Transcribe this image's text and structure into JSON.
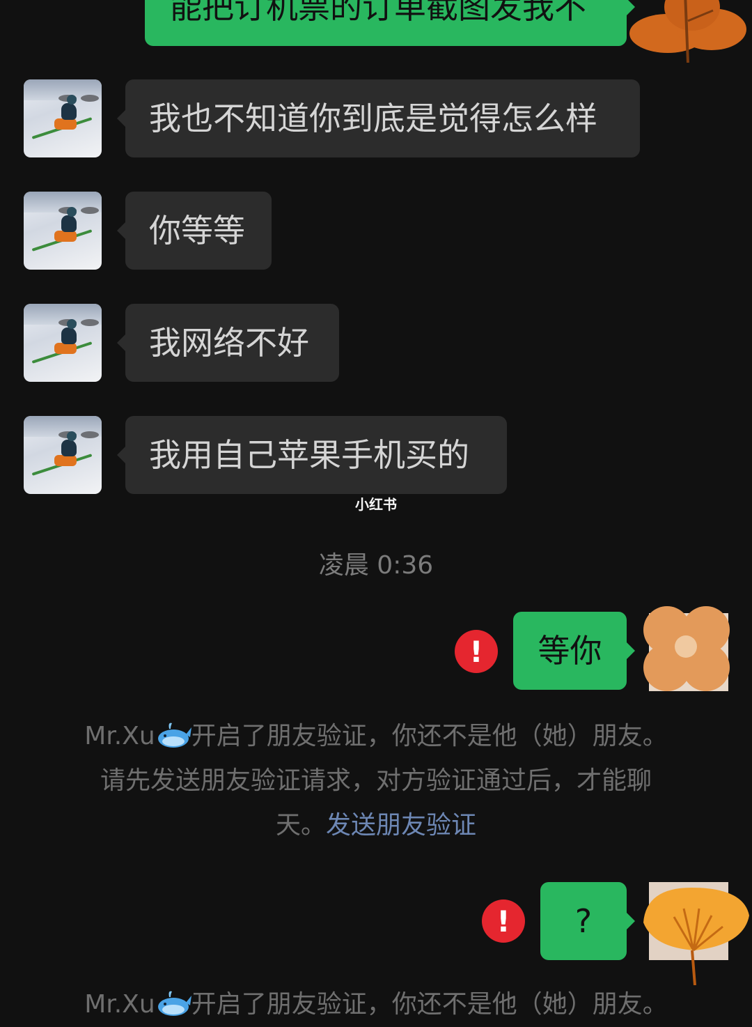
{
  "top_partial_message": {
    "text": "能把订机票的订单截图发我不"
  },
  "incoming_messages": [
    {
      "text": "我也不知道你到底是觉得怎么样"
    },
    {
      "text": "你等等"
    },
    {
      "text": "我网络不好"
    },
    {
      "text": "我用自己苹果手机买的"
    }
  ],
  "watermark": "小红书",
  "timestamp": "凌晨 0:36",
  "outgoing_messages": [
    {
      "text": "等你",
      "error_icon": "!"
    },
    {
      "text": "?",
      "error_icon": "!"
    }
  ],
  "system_notice": {
    "line1_name": "Mr.Xu",
    "line1_rest": "开启了朋友验证，你还不是他（她）朋友。",
    "line2": "请先发送朋友验证请求，对方验证通过后，才能聊",
    "line3_prefix": "天。",
    "line3_link": "发送朋友验证"
  },
  "colors": {
    "background": "#111111",
    "incoming_bubble": "#2c2c2c",
    "outgoing_bubble": "#29b75f",
    "error_badge": "#e5262f",
    "link": "#6d87b4"
  },
  "icons": [
    "ski-avatar",
    "flower-avatar",
    "whale-emoji",
    "error-icon"
  ]
}
